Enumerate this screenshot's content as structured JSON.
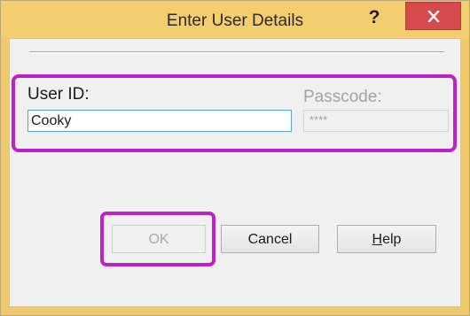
{
  "window": {
    "title": "Enter User Details",
    "help_glyph": "?",
    "close_icon": "close-icon"
  },
  "form": {
    "user_id_label": "User ID:",
    "user_id_value": "Cooky",
    "passcode_label": "Passcode:",
    "passcode_value": "****"
  },
  "buttons": {
    "ok_label": "OK",
    "cancel_label": "Cancel",
    "help_label_mnemonic": "H",
    "help_label_rest": "elp"
  },
  "colors": {
    "titlebar": "#f3cd70",
    "close_button": "#d6494d",
    "highlight": "#c020c8",
    "input_focus_border": "#5ea0e6"
  }
}
